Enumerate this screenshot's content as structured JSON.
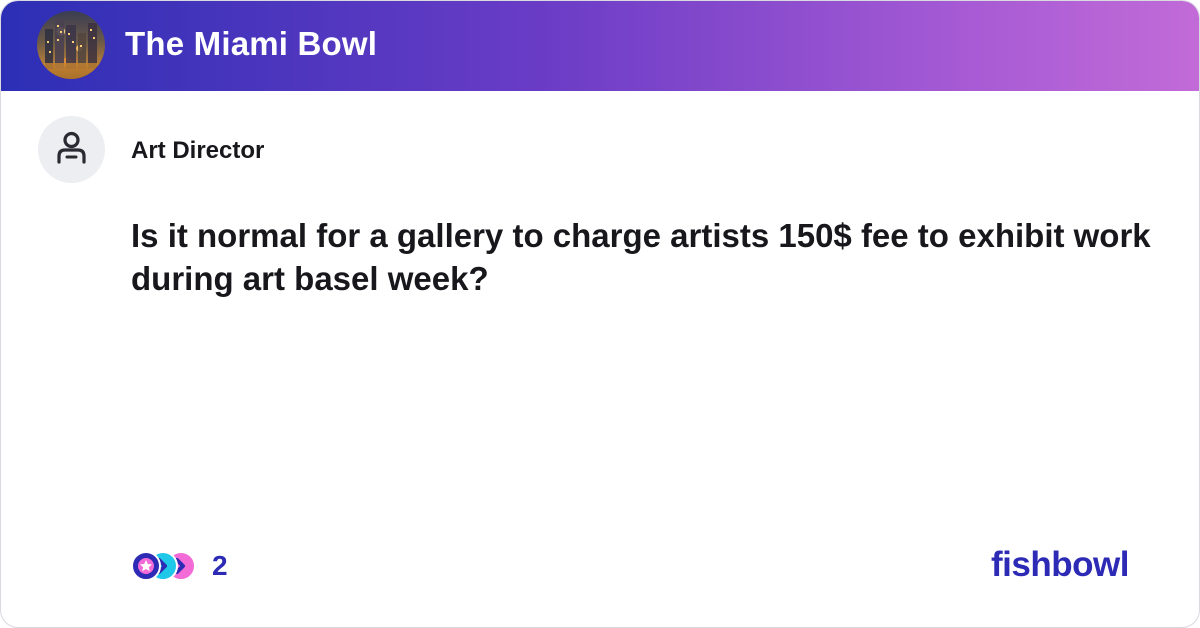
{
  "header": {
    "bowl_name": "The Miami Bowl",
    "avatar_icon": "city-skyline-photo",
    "gradient_colors": [
      "#2c2fb5",
      "#6a3cc6",
      "#a65ad4",
      "#c26bd8"
    ]
  },
  "post": {
    "author_title": "Art Director",
    "author_icon": "user-icon",
    "question": "Is it normal for a gallery to charge artists 150$ fee to exhibit work during art basel week?"
  },
  "footer": {
    "reaction_icons": [
      "reaction-heart-icon",
      "reaction-laugh-icon",
      "reaction-star-icon"
    ],
    "reaction_count": "2",
    "brand": "fishbowl",
    "brand_color": "#2d2bb5"
  }
}
